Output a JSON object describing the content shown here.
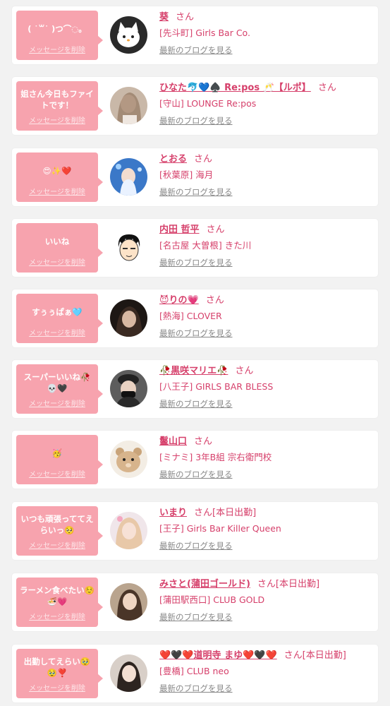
{
  "delete_label": "メッセージを削除",
  "blog_label": "最新のブログを見る",
  "honorific": "さん",
  "colors": {
    "bubble": "#f7a3ae",
    "name": "#d6406b",
    "background": "#f2f2f2"
  },
  "cards": [
    {
      "message": "( ˙꒳˙ )つ⌒◌。",
      "name": "葵",
      "suffix": "さん",
      "shop": "[先斗町] Girls Bar Co.",
      "avatar_style": "cat"
    },
    {
      "message": "姐さん今日もファイトです！",
      "name": "ひなた🐬💙♠️ Re:pos 🥂【ルポ】",
      "suffix": "さん",
      "shop": "[守山] LOUNGE Re:pos",
      "avatar_style": "woman"
    },
    {
      "message": "😍✨❤️",
      "name": "とおる",
      "suffix": "さん",
      "shop": "[秋葉原] 海月",
      "avatar_style": "blue"
    },
    {
      "message": "いいね",
      "name": "内田 哲平",
      "suffix": "さん",
      "shop": "[名古屋 大曽根] きた川",
      "avatar_style": "cartoon"
    },
    {
      "message": "すぅぅぱぁ🩵",
      "name": "😈りの💗",
      "suffix": "さん",
      "shop": "[熱海] CLOVER",
      "avatar_style": "dark"
    },
    {
      "message": "スーパーいいね🥀💀🖤",
      "name": "🥀黒咲マリエ🥀",
      "suffix": "さん",
      "shop": "[八王子] GIRLS BAR BLESS",
      "avatar_style": "dark2"
    },
    {
      "message": "🥳",
      "name": "鬣山口",
      "suffix": "さん",
      "shop": "[ミナミ] 3年B組 宗右衛門校",
      "avatar_style": "bear"
    },
    {
      "message": "いつも頑張っててえらいっ🥺",
      "name": "いまり",
      "suffix": "さん[本日出勤]",
      "shop": "[王子] Girls Bar Killer Queen",
      "avatar_style": "pink"
    },
    {
      "message": "ラーメン食べたい☺️🍜💗",
      "name": "みさと(蒲田ゴールド)",
      "suffix": "さん[本日出勤]",
      "shop": "[蒲田駅西口] CLUB GOLD",
      "avatar_style": "woman2"
    },
    {
      "message": "出勤してえらい🥹🥹❣️",
      "name": "❤️🖤❤️道明寺 まゆ❤️🖤❤️",
      "suffix": "さん[本日出勤]",
      "shop": "[豊橋] CLUB neo",
      "avatar_style": "woman3"
    }
  ]
}
